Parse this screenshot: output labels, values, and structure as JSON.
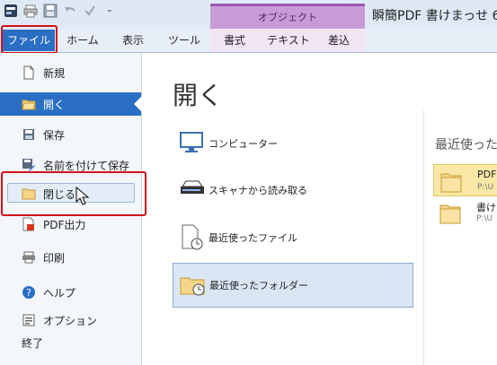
{
  "app_title": "瞬簡PDF 書けまっせ 6",
  "context_group_label": "オブジェクト",
  "tabs": [
    "ファイル",
    "ホーム",
    "表示",
    "ツール",
    "書式",
    "テキスト",
    "差込"
  ],
  "sidebar": {
    "items": [
      {
        "label": "新規",
        "icon": "new-document-icon"
      },
      {
        "label": "開く",
        "icon": "open-folder-icon"
      },
      {
        "label": "保存",
        "icon": "save-icon"
      },
      {
        "label": "名前を付けて保存",
        "icon": "save-as-icon"
      },
      {
        "label": "閉じる",
        "icon": "close-folder-icon"
      },
      {
        "label": "PDF出力",
        "icon": "pdf-export-icon"
      },
      {
        "label": "印刷",
        "icon": "print-icon"
      },
      {
        "label": "ヘルプ",
        "icon": "help-icon"
      },
      {
        "label": "オプション",
        "icon": "options-icon"
      },
      {
        "label": "終了",
        "icon": ""
      }
    ]
  },
  "main": {
    "title": "開く",
    "options": [
      {
        "label": "コンピューター",
        "icon": "computer-icon"
      },
      {
        "label": "スキャナから読み取る",
        "icon": "scanner-icon"
      },
      {
        "label": "最近使ったファイル",
        "icon": "recent-file-icon"
      },
      {
        "label": "最近使ったフォルダー",
        "icon": "recent-folder-icon"
      }
    ],
    "recent_title": "最近使った",
    "recent_items": [
      {
        "name": "PDF",
        "path": "P:\\U"
      },
      {
        "name": "書け",
        "path": "P:\\U"
      }
    ]
  },
  "colors": {
    "accent": "#2b6fc4",
    "highlight_red": "#d0121b",
    "context_purple": "#c89ad6"
  }
}
